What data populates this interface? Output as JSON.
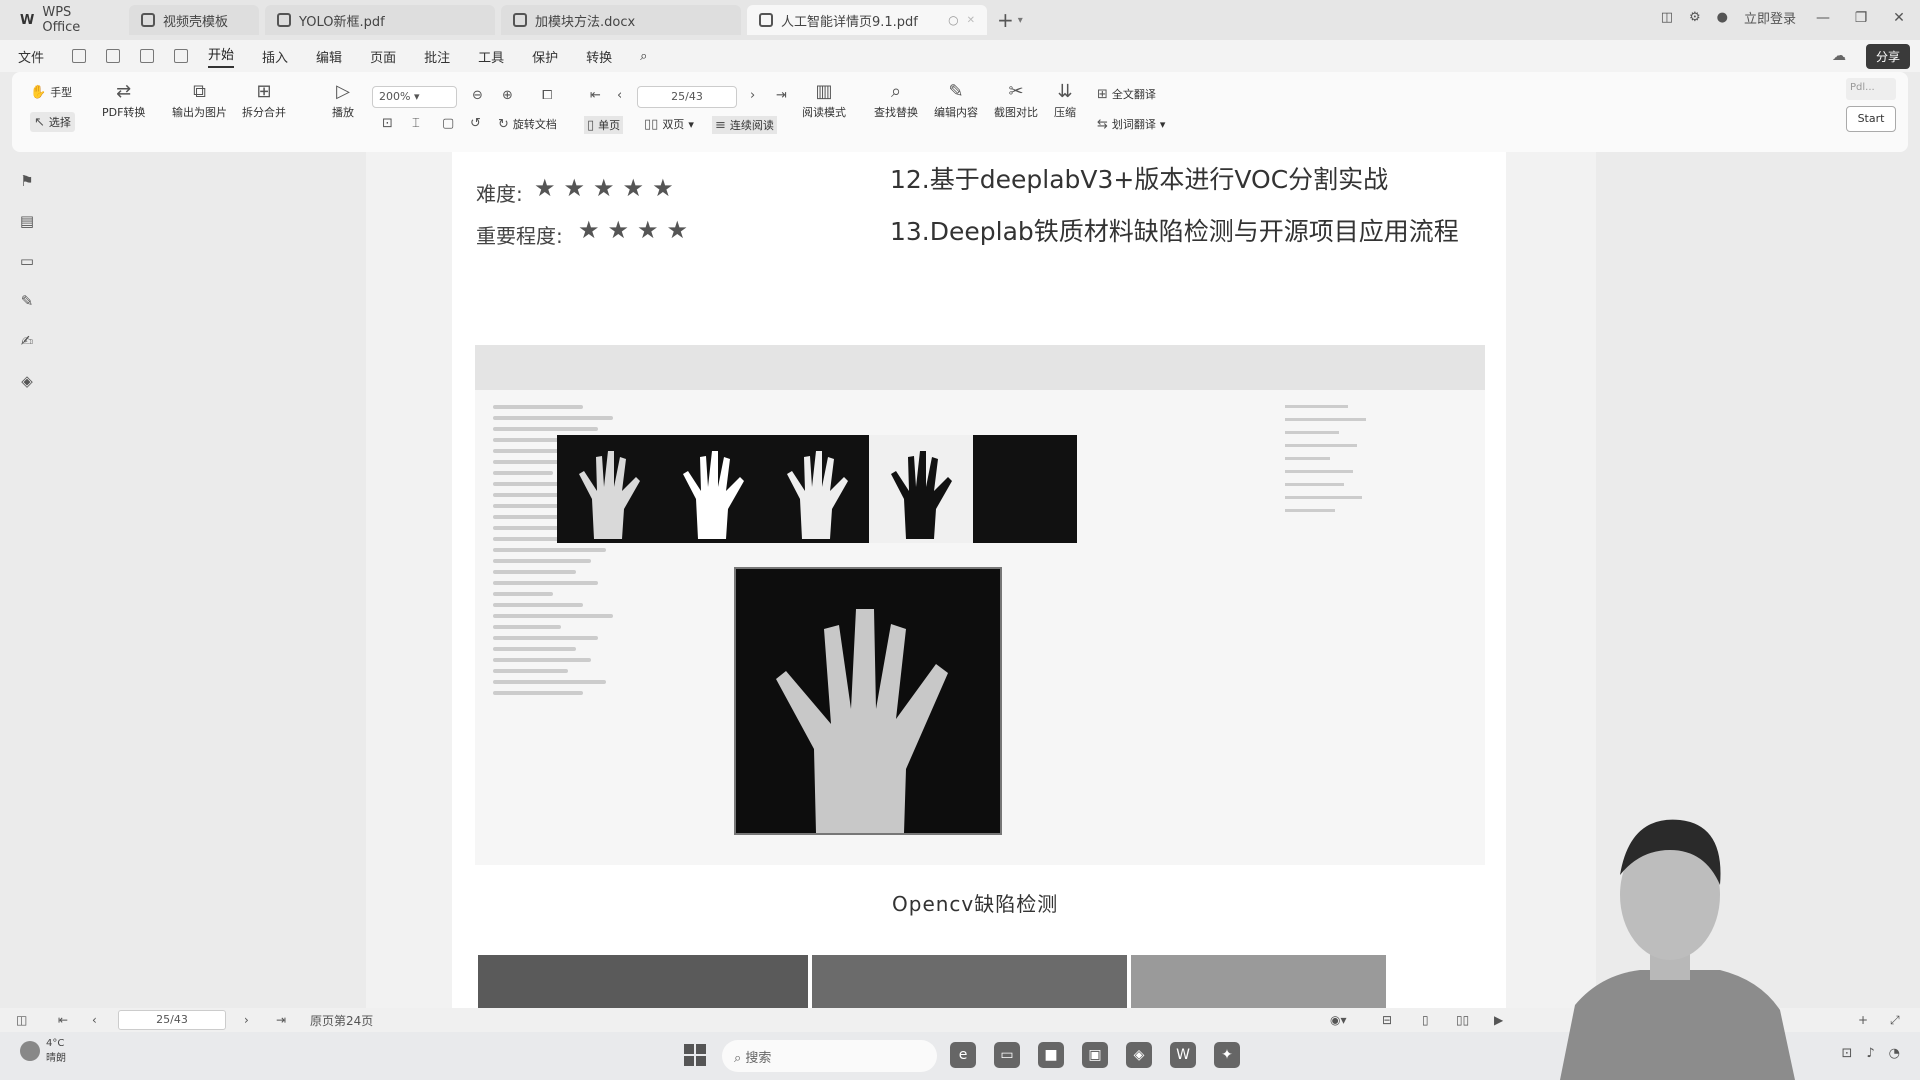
{
  "tabs": [
    {
      "label": "WPS Office"
    },
    {
      "label": "视频壳模板"
    },
    {
      "label": "YOLO新框.pdf"
    },
    {
      "label": "加模块方法.docx"
    },
    {
      "label": "人工智能详情页9.1.pdf"
    }
  ],
  "titlebar": {
    "login": "立即登录"
  },
  "menu": {
    "file": "文件",
    "items": [
      "开始",
      "插入",
      "编辑",
      "页面",
      "批注",
      "工具",
      "保护",
      "转换"
    ],
    "share": "分享"
  },
  "toolbar": {
    "hand": "手型",
    "select": "选择",
    "pdf_convert": "PDF转换",
    "export_image": "输出为图片",
    "split_merge": "拆分合并",
    "play": "播放",
    "zoom": "200%",
    "page": "25/43",
    "rotate": "旋转文档",
    "single_page": "单页",
    "double_page": "双页",
    "continuous": "连续阅读",
    "read_mode": "阅读模式",
    "find_replace": "查找替换",
    "edit_content": "编辑内容",
    "screenshot_compare": "截图对比",
    "compress": "压缩",
    "full_translate": "全文翻译",
    "word_translate": "划词翻译",
    "start": "Start",
    "pdf_mini": "Pdl..."
  },
  "document": {
    "difficulty_label": "难度:",
    "difficulty_stars": "★★★★★",
    "importance_label": "重要程度:",
    "importance_stars": "★★★★",
    "line12": "12.基于deeplabV3+版本进行VOC分割实战",
    "line13": "13.Deeplab铁质材料缺陷检测与开源项目应用流程",
    "caption": "Opencv缺陷检测"
  },
  "statusbar": {
    "page": "25/43",
    "original_page": "原页第24页"
  },
  "taskbar": {
    "temp": "4°C",
    "weather": "晴朗",
    "search": "搜索"
  },
  "colors": {
    "active_tab": "#f7f7f7",
    "toolbar_bg": "#fafafa",
    "share_bg": "#3a3a3a",
    "page_bg": "#ffffff"
  }
}
